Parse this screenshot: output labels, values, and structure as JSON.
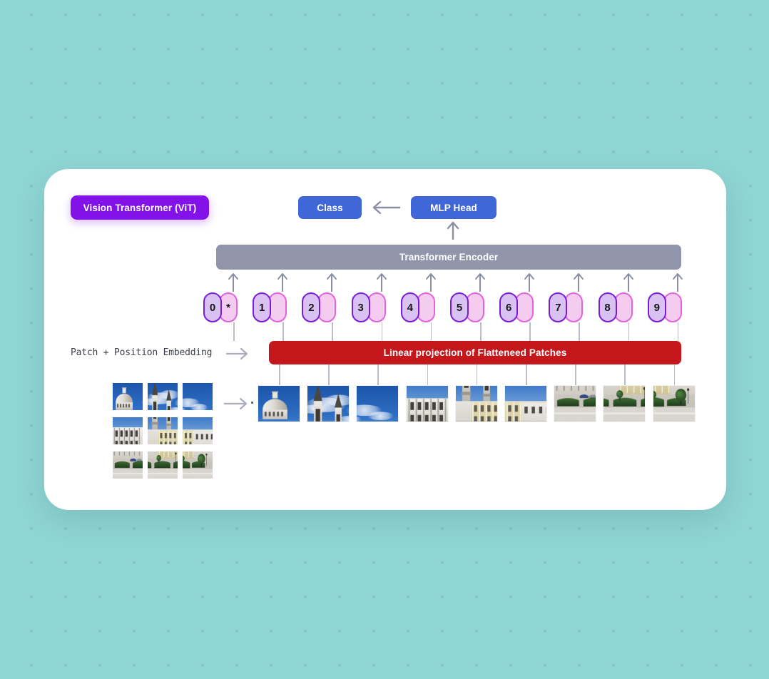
{
  "page": {
    "background_color": "#8fd5d4",
    "card_color": "#ffffff"
  },
  "diagram": {
    "title_badge": {
      "label": "Vision Transformer (ViT)",
      "color": "#8312e8"
    },
    "class_badge": {
      "label": "Class",
      "color": "#3f67d8"
    },
    "mlp_head_badge": {
      "label": "MLP Head",
      "color": "#3f67d8"
    },
    "encoder_bar": {
      "label": "Transformer Encoder",
      "color": "#9195ab"
    },
    "linear_projection_bar": {
      "label": "Linear projection of Flatteneed Patches",
      "color": "#c4171b"
    },
    "embedding_label": "Patch + Position Embedding",
    "arrows": {
      "class_from_mlp": "arrow-left-icon",
      "mlp_from_encoder": "arrow-up-icon",
      "grid_to_patches": "arrow-right-icon"
    },
    "tokens": [
      {
        "number": "0",
        "position_token": "*"
      },
      {
        "number": "1",
        "position_token": ""
      },
      {
        "number": "2",
        "position_token": ""
      },
      {
        "number": "3",
        "position_token": ""
      },
      {
        "number": "4",
        "position_token": ""
      },
      {
        "number": "5",
        "position_token": ""
      },
      {
        "number": "6",
        "position_token": ""
      },
      {
        "number": "7",
        "position_token": ""
      },
      {
        "number": "8",
        "position_token": ""
      },
      {
        "number": "9",
        "position_token": ""
      }
    ],
    "token_colors": {
      "number_border": "#7a1cd6",
      "number_fill": "#d9c2f2",
      "position_border": "#e263dd",
      "position_fill": "#f3ccf0"
    },
    "source_image": {
      "description": "Photograph of a baroque palace facade with blue sky, split into a 3x3 patch grid",
      "grid_rows": 3,
      "grid_cols": 3
    },
    "patch_strip_count": 9
  }
}
